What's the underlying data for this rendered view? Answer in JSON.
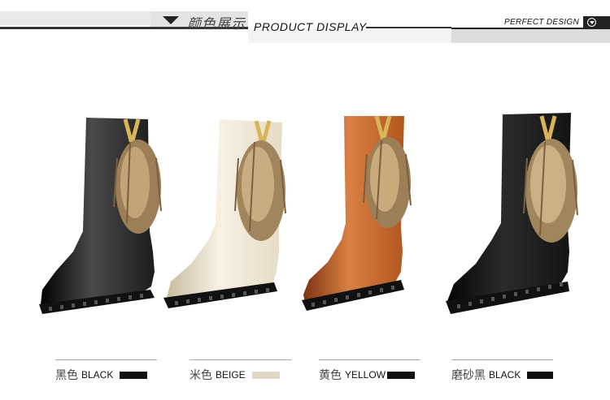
{
  "header": {
    "zh_title": "颜色展示",
    "en_title": "PRODUCT DISPLAY",
    "right_label": "PERFECT DESIGN"
  },
  "products": [
    {
      "zh": "黑色",
      "en": "BLACK",
      "swatch": "#111111",
      "boot_color": "#1c1c1c",
      "boot_shade": "#000000",
      "boot_hi": "#4a4a4a"
    },
    {
      "zh": "米色",
      "en": "BEIGE",
      "swatch": "#e2d8c6",
      "boot_color": "#e6dcc6",
      "boot_shade": "#c9bc9f",
      "boot_hi": "#f7f1e3"
    },
    {
      "zh": "黄色",
      "en": "YELLOW",
      "swatch": "#111111",
      "boot_color": "#b2571f",
      "boot_shade": "#7d3410",
      "boot_hi": "#d98044"
    },
    {
      "zh": "磨砂黑",
      "en": "BLACK",
      "swatch": "#111111",
      "boot_color": "#141414",
      "boot_shade": "#050505",
      "boot_hi": "#2a2a2a"
    }
  ]
}
